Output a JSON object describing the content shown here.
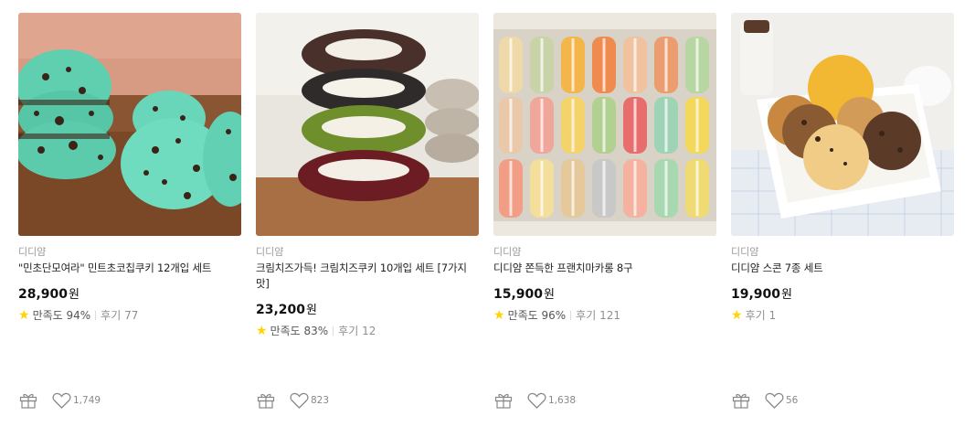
{
  "products": [
    {
      "brand": "디디얌",
      "title": "\"민초단모여라\" 민트초코칩쿠키 12개입 세트",
      "price": "28,900",
      "currency": "원",
      "satisfaction": "만족도 94%",
      "reviews": "후기 77",
      "likes": "1,749",
      "image": "mint-chocolate-chip-cookies"
    },
    {
      "brand": "디디얌",
      "title": "크림치즈가득! 크림치즈쿠키 10개입 세트 [7가지 맛]",
      "price": "23,200",
      "currency": "원",
      "satisfaction": "만족도 83%",
      "reviews": "후기 12",
      "likes": "823",
      "image": "cream-cheese-cookies-stack"
    },
    {
      "brand": "디디얌",
      "title": "디디얌 쫀득한 프랜치마카롱 8구",
      "price": "15,900",
      "currency": "원",
      "satisfaction": "만족도 96%",
      "reviews": "후기 121",
      "likes": "1,638",
      "image": "french-macarons-box"
    },
    {
      "brand": "디디얌",
      "title": "디디얌 스콘 7종 세트",
      "price": "19,900",
      "currency": "원",
      "satisfaction": "",
      "reviews": "후기 1",
      "likes": "56",
      "image": "scones-in-white-dish"
    }
  ],
  "colors": {
    "star": "#ffd400",
    "price": "#111111",
    "muted": "#9a9a9a"
  }
}
